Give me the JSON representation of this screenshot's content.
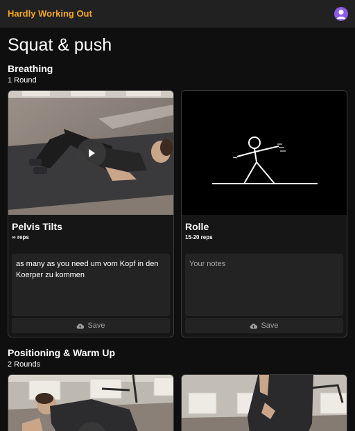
{
  "app": {
    "title": "Hardly Working Out"
  },
  "page": {
    "title": "Squat & push"
  },
  "sections": [
    {
      "title": "Breathing",
      "rounds": "1 Round",
      "exercises": [
        {
          "name": "Pelvis Tilts",
          "reps": "∞ reps",
          "notes_value": "as many as you need um vom Kopf in den Koerper zu kommen",
          "notes_placeholder": "Your notes",
          "save_label": "Save"
        },
        {
          "name": "Rolle",
          "reps": "15-20 reps",
          "notes_value": "",
          "notes_placeholder": "Your notes",
          "save_label": "Save"
        }
      ]
    },
    {
      "title": "Positioning & Warm Up",
      "rounds": "2 Rounds",
      "exercises": []
    }
  ],
  "icons": {
    "avatar": "user-avatar-icon",
    "play": "play-icon",
    "save": "cloud-upload-icon"
  },
  "colors": {
    "accent": "#f5a623",
    "avatar": "#8e59e6",
    "background": "#0f0f0f",
    "topbar": "#212121"
  }
}
